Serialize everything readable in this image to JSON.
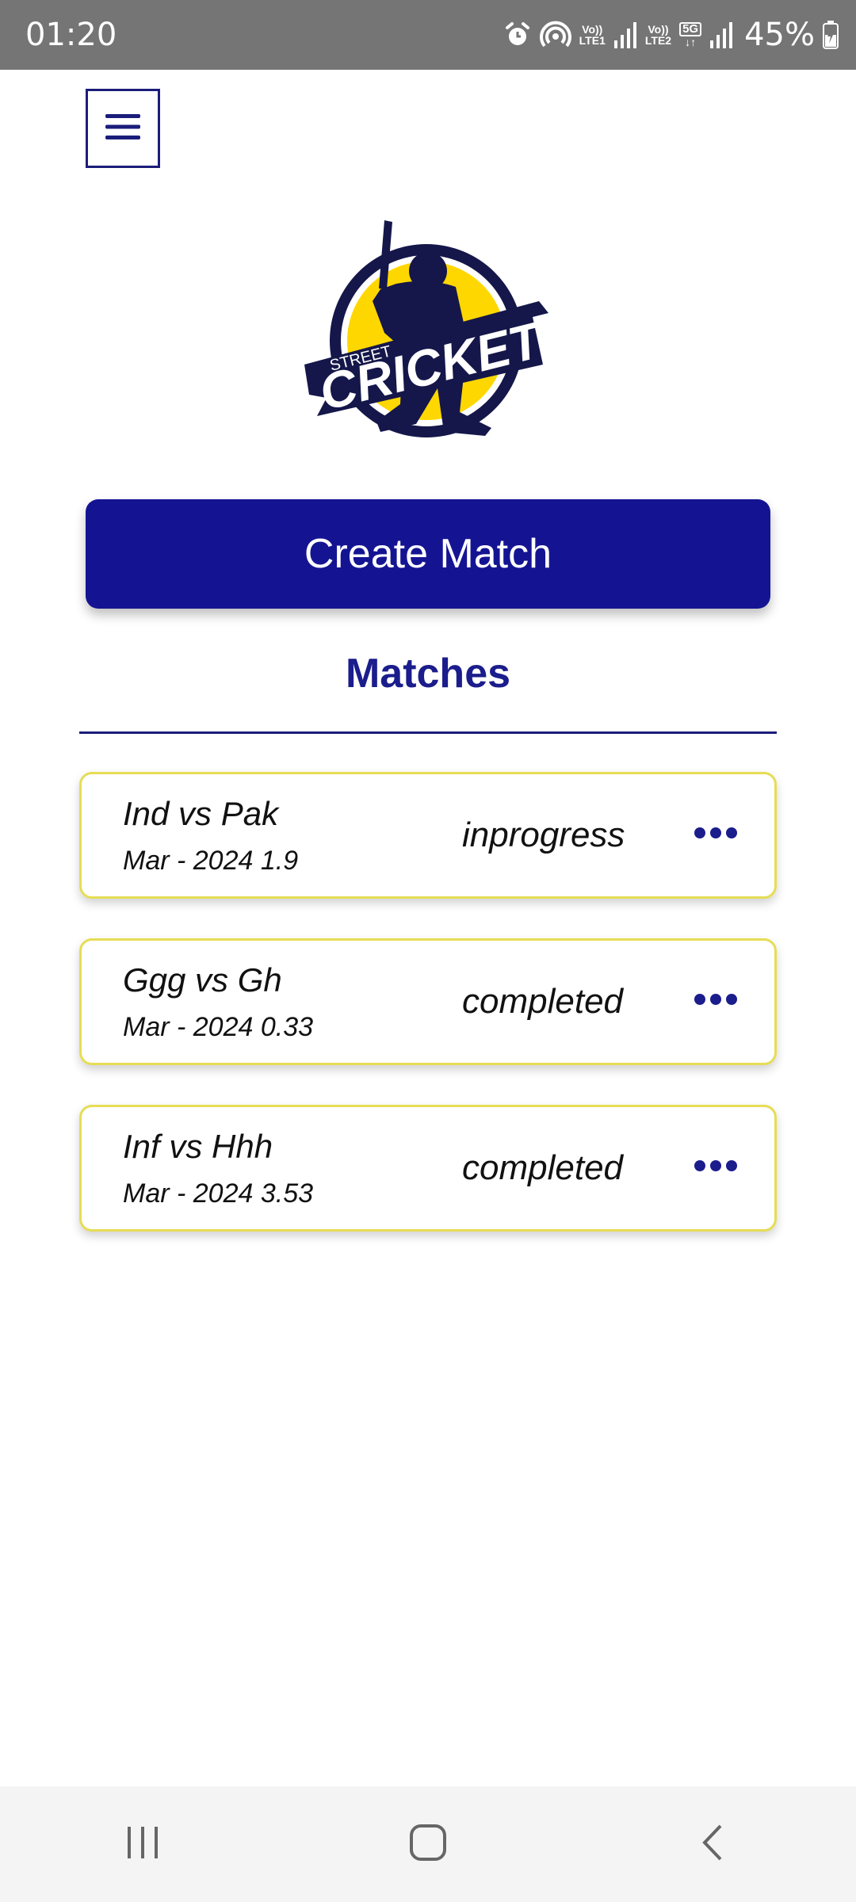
{
  "status_bar": {
    "time": "01:20",
    "sim1_label_top": "Vo))",
    "sim1_label_bottom": "LTE1",
    "sim2_label_top": "Vo))",
    "sim2_label_bottom": "LTE2",
    "network_badge": "5G",
    "battery": "45%",
    "icons": [
      "alarm-icon",
      "hotspot-icon",
      "signal-icon",
      "signal-icon",
      "battery-charging-icon"
    ]
  },
  "header": {
    "menu_icon": "hamburger-menu-icon"
  },
  "logo": {
    "top_text": "STREET",
    "main_text": "CRICKET",
    "colors": {
      "navy": "#15174a",
      "yellow": "#ffd700"
    }
  },
  "actions": {
    "create_match_label": "Create Match"
  },
  "matches": {
    "title": "Matches",
    "items": [
      {
        "name": "Ind vs Pak",
        "date": "Mar - 2024 1.9",
        "status": "inprogress"
      },
      {
        "name": "Ggg vs Gh",
        "date": "Mar - 2024 0.33",
        "status": "completed"
      },
      {
        "name": "Inf vs Hhh",
        "date": "Mar - 2024 3.53",
        "status": "completed"
      }
    ]
  },
  "nav_bar": {
    "icons": [
      "recents-icon",
      "home-icon",
      "back-icon"
    ]
  },
  "colors": {
    "primary": "#141493",
    "title": "#1b1d8c",
    "card_border": "#e6dd55",
    "status_bar": "#757575"
  }
}
